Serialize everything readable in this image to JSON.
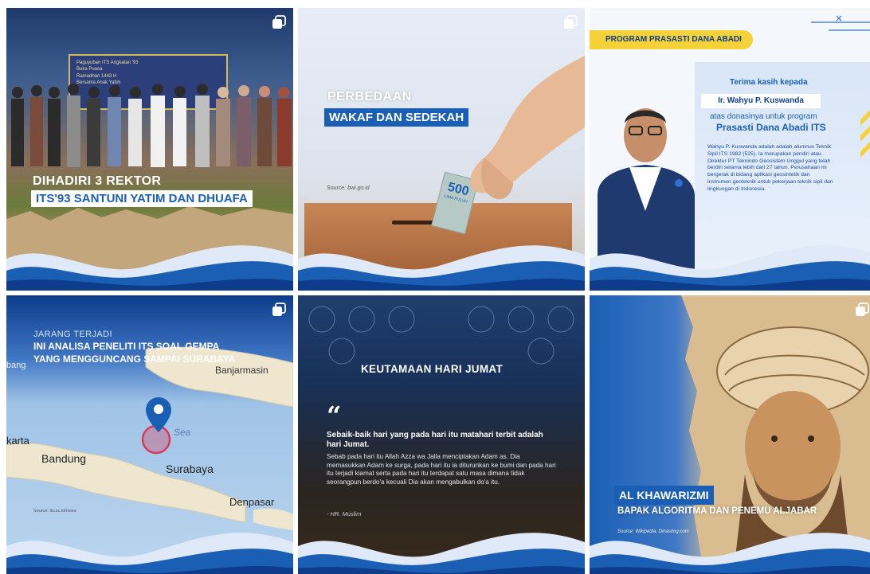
{
  "colors": {
    "brand_blue": "#1a5fb4",
    "deep_blue": "#0d3d8a",
    "yellow": "#f6d23a",
    "paper": "#eef3fb"
  },
  "icons": {
    "multi": "multiple-photos-icon",
    "map_pin": "map-pin-icon",
    "quote": "quote-icon"
  },
  "posts": {
    "p1": {
      "line1": "DIHADIRI 3 REKTOR",
      "line2": "ITS'93 SANTUNI YATIM DAN DHUAFA",
      "banner_line1": "Paguyuban ITS Angkatan '93",
      "banner_line2": "Buka Puasa",
      "banner_line3": "Ramadhan 1443 H",
      "banner_line4": "Bersama Anak Yatim"
    },
    "p2": {
      "line1": "PERBEDAAN",
      "line2": "WAKAF DAN SEDEKAH",
      "source": "Source: bwi.go.id",
      "note_value": "500",
      "note_text": "LIMA PULUH"
    },
    "p3": {
      "program": "PROGRAM PRASASTI DANA ABADI",
      "thanks": "Terima kasih kepada",
      "name": "Ir. Wahyu P. Kuswanda",
      "donation": "atas donasinya untuk program",
      "program_name": "Prasasti Dana Abadi ITS",
      "bio": "Wahyu P. Kuswanda adalah adalah alumnus Teknik Sipil ITS 1982 (525). Ia merupakan pendiri atau Direktur PT Teknindo Geosistem Unggul yang telah berdiri selama lebih dari 27 tahun. Perusahaan ini bergerak di bidang aplikasi geosintetik dan instrumen geoteknik untuk pekerjaan teknik sipil dan lingkungan di Indonesia."
    },
    "p4": {
      "kicker": "JARANG TERJADI",
      "line1": "INI ANALISA PENELITI ITS SOAL GEMPA",
      "line2": "YANG MENGGUNCANG SAMPAI SURABAYA",
      "source": "Source: its.ac.id/news",
      "map_labels": {
        "banjarmasin": "Banjarmasin",
        "sea": "Sea",
        "karta": "karta",
        "bandung": "Bandung",
        "surabaya": "Surabaya",
        "denpasar": "Denpasar",
        "bang": "bang"
      }
    },
    "p5": {
      "title": "KEUTAMAAN HARI JUMAT",
      "quote_bold": "Sebaik-baik hari yang pada hari itu matahari terbit adalah hari Jumat.",
      "quote_body": "Sebab pada hari itu Allah Azza wa Jalla menciptakan Adam as. Dia memasukkan Adam ke surga, pada hari itu ia diturunkan ke bumi dan pada hari itu terjadi kiamat serta pada hari itu terdapat satu masa dimana tidak seorangpun berdo'a kecuali Dia akan mengabulkan do'a itu.",
      "attribution": "- HR. Muslim"
    },
    "p6": {
      "name": "AL KHAWARIZMI",
      "subtitle": "BAPAK ALGORITMA DAN PENEMU ALJABAR",
      "source": "Source: Wikipedia, Dinasting.com"
    }
  }
}
